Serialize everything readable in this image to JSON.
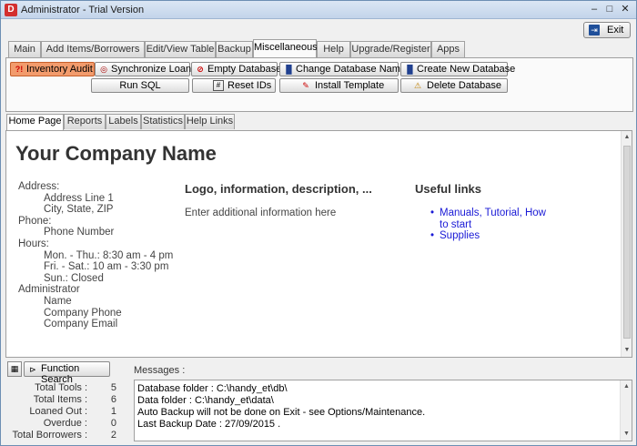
{
  "window": {
    "app_icon": "D",
    "title": "Administrator - Trial Version",
    "controls": {
      "minimize": "–",
      "maximize": "□",
      "close": "✕"
    }
  },
  "exit_button": {
    "label": "Exit",
    "icon": "exit-door-icon"
  },
  "main_tabs": [
    {
      "label": "Main"
    },
    {
      "label": "Add Items/Borrowers"
    },
    {
      "label": "Edit/View Table"
    },
    {
      "label": "Backup"
    },
    {
      "label": "Miscellaneous",
      "active": true
    },
    {
      "label": "Help"
    },
    {
      "label": "Upgrade/Register"
    },
    {
      "label": "Apps"
    }
  ],
  "toolbar": {
    "inventory_audit": {
      "label": "Inventory Audit",
      "icon": "audit-icon"
    },
    "synchronize_loans": {
      "label": "Synchronize Loans",
      "icon": "sync-icon"
    },
    "empty_database": {
      "label": "Empty Database",
      "icon": "empty-db-icon"
    },
    "change_database_name": {
      "label": "Change Database Name",
      "icon": "database-icon"
    },
    "create_new_database": {
      "label": "Create New Database",
      "icon": "database-icon"
    },
    "run_sql": {
      "label": "Run SQL"
    },
    "reset_ids": {
      "label": "Reset IDs",
      "icon": "ids-icon"
    },
    "install_template": {
      "label": "Install Template",
      "icon": "template-icon"
    },
    "delete_database": {
      "label": "Delete Database",
      "icon": "warning-icon"
    }
  },
  "sub_tabs": [
    {
      "label": "Home Page",
      "active": true
    },
    {
      "label": "Reports"
    },
    {
      "label": "Labels"
    },
    {
      "label": "Statistics"
    },
    {
      "label": "Help Links"
    }
  ],
  "home": {
    "company_name": "Your Company Name",
    "address_label": "Address:",
    "address_lines": [
      "Address Line 1",
      "City, State, ZIP"
    ],
    "phone_label": "Phone:",
    "phone_number": "Phone Number",
    "hours_label": "Hours:",
    "hours_lines": [
      "Mon. - Thu.: 8:30 am - 4 pm",
      "Fri. - Sat.: 10 am - 3:30 pm",
      "Sun.: Closed"
    ],
    "admin_label": "Administrator",
    "admin_lines": [
      "Name",
      "Company Phone",
      "Company Email"
    ],
    "logo_heading": "Logo, information, description, ...",
    "logo_text": "Enter additional information here",
    "links_heading": "Useful links",
    "links": [
      "Manuals, Tutorial, How to start",
      "Supplies"
    ]
  },
  "bottom": {
    "function_search_label": "Function Search",
    "function_search_icon": "search-function-icon",
    "grid_icon": "grid-icon",
    "messages_label": "Messages :",
    "stats": [
      {
        "label": "Total Tools :",
        "value": "5"
      },
      {
        "label": "Total Items :",
        "value": "6"
      },
      {
        "label": "Loaned Out :",
        "value": "1"
      },
      {
        "label": "Overdue :",
        "value": "0"
      },
      {
        "label": "Total Borrowers :",
        "value": "2"
      }
    ],
    "messages": [
      "Database folder : C:\\handy_et\\db\\",
      "Data folder : C:\\handy_et\\data\\",
      "Auto Backup will not be done on Exit - see Options/Maintenance.",
      "Last Backup Date : 27/09/2015 ."
    ]
  }
}
